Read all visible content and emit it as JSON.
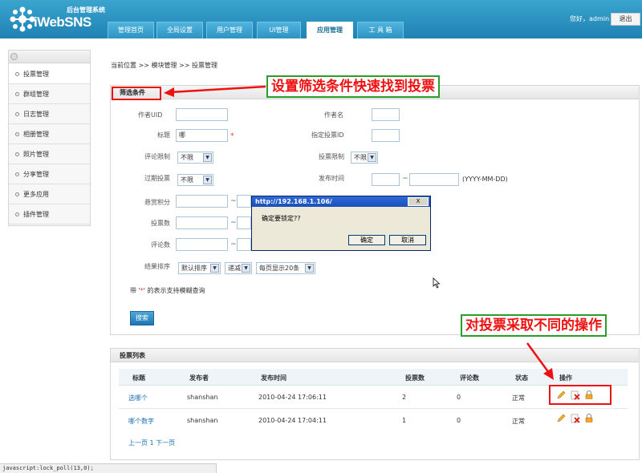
{
  "header": {
    "logo_sub": "后台管理系统",
    "logo_main": "iWebSNS",
    "tabs": [
      {
        "label": "管理首页"
      },
      {
        "label": "全局设置"
      },
      {
        "label": "用户管理"
      },
      {
        "label": "UI管理"
      },
      {
        "label": "应用管理"
      },
      {
        "label": "工 具 箱"
      }
    ],
    "active_tab": "应用管理",
    "greeting": "您好，admin",
    "logout_label": "退出"
  },
  "sidebar": {
    "items": [
      {
        "label": "投票管理"
      },
      {
        "label": "群组管理"
      },
      {
        "label": "日志管理"
      },
      {
        "label": "相册管理"
      },
      {
        "label": "照片管理"
      },
      {
        "label": "分享管理"
      },
      {
        "label": "更多应用"
      },
      {
        "label": "插件管理"
      }
    ],
    "active_item": "投票管理"
  },
  "breadcrumb": "当前位置 >> 模块管理 >> 投票管理",
  "filter": {
    "title": "筛选条件",
    "fields": {
      "author_uid_label": "作者UID",
      "author_name_label": "作者名",
      "title_label": "标题",
      "title_value": "哪",
      "required_star": "*",
      "vote_id_label": "指定投票ID",
      "comment_limit_label": "评论限制",
      "comment_limit_value": "不限",
      "vote_limit_label": "投票限制",
      "vote_limit_value": "不限",
      "expired_label": "过期投票",
      "expired_value": "不限",
      "publish_time_label": "发布时间",
      "date_format_hint": "(YYYY-MM-DD)",
      "reward_label": "悬赏积分",
      "vote_count_label": "投票数",
      "comment_count_label": "评论数",
      "sort_label": "结果排序",
      "sort_by_value": "默认排序",
      "sort_order_value": "递减",
      "per_page_value": "每页显示20条",
      "tilde": "~"
    },
    "fuzzy_note_prefix": "带 '",
    "fuzzy_note_star": "*",
    "fuzzy_note_suffix": "' 的表示支持模糊查询",
    "search_label": "搜索"
  },
  "dialog": {
    "title": "http://192.168.1.106/",
    "close_label": "X",
    "message": "确定要锁定??",
    "ok_label": "确定",
    "cancel_label": "取消"
  },
  "list": {
    "title": "投票列表",
    "columns": [
      "标题",
      "发布者",
      "发布时间",
      "投票数",
      "评论数",
      "状态",
      "操作"
    ],
    "rows": [
      {
        "title": "选哪个",
        "publisher": "shanshan",
        "time": "2010-04-24 17:06:11",
        "votes": "2",
        "comments": "0",
        "status": "正常"
      },
      {
        "title": "哪个数字",
        "publisher": "shanshan",
        "time": "2010-04-24 17:04:11",
        "votes": "1",
        "comments": "0",
        "status": "正常"
      }
    ],
    "pager": "上一页 1 下一页"
  },
  "annotations": {
    "filter_callout": "设置筛选条件快速找到投票",
    "ops_callout": "对投票采取不同的操作"
  },
  "statusbar": "javascript:lock_poll(13,0);",
  "colors": {
    "header": "#2b93c4",
    "callout_text": "#e11111",
    "callout_border": "#2a9d2a",
    "link": "#1a6fb0"
  }
}
